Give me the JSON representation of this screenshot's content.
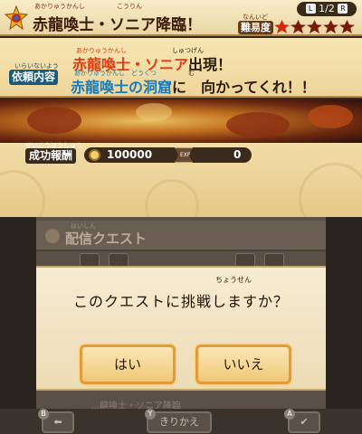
{
  "header": {
    "title": "赤龍喚士・ソニア降臨！",
    "title_ruby": "あかりゅうかんし　　　　　こうりん",
    "page_label": "1/2",
    "page_left_btn": "L",
    "page_right_btn": "R",
    "difficulty_label": "難易度",
    "difficulty_ruby": "なんいど",
    "difficulty_stars_on": 1,
    "difficulty_stars_total": 5
  },
  "request": {
    "label": "依頼内容",
    "label_ruby": "いらいないよう",
    "line1_red": "赤龍喚士・ソニア",
    "line1_rest": "出現！",
    "line1_ruby_red": "あかりゅうかんし",
    "line1_ruby_rest": "しゅつげん",
    "line2_blue": "赤龍喚士の洞窟",
    "line2_rest": "に　向かってくれ！！",
    "line2_ruby_blue": "あかりゅうかんし　どうくつ",
    "line2_ruby_rest": "む"
  },
  "reward": {
    "label": "成功報酬",
    "label_ruby": "せいこうほうしゅう",
    "money": "100000",
    "exp_icon": "EXP",
    "exp": "0"
  },
  "background_menu": {
    "title": "配信クエスト",
    "title_ruby": "はいしん",
    "row_text": "…龍喚士・ソニア降臨",
    "footer_switch": "きりかえ",
    "footer_b": "B",
    "footer_y": "Y",
    "footer_a": "A"
  },
  "dialog": {
    "message": "このクエストに挑戦しますか？",
    "message_ruby": "ちょうせん",
    "yes": "はい",
    "no": "いいえ"
  },
  "colors": {
    "accent_orange": "#e49a3a",
    "red_text": "#e23a10",
    "blue_text": "#1a7ab8"
  }
}
